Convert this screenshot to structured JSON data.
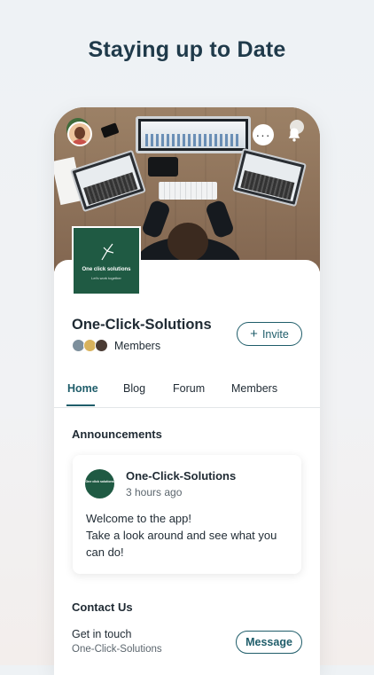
{
  "headline": "Staying up to Date",
  "group": {
    "name": "One-Click-Solutions",
    "members_label": "Members",
    "invite_label": "Invite",
    "logo_title": "One click solutions",
    "logo_subtitle": "Let's work together"
  },
  "tabs": [
    {
      "label": "Home",
      "active": true
    },
    {
      "label": "Blog",
      "active": false
    },
    {
      "label": "Forum",
      "active": false
    },
    {
      "label": "Members",
      "active": false
    }
  ],
  "announcements": {
    "title": "Announcements",
    "post": {
      "author": "One-Click-Solutions",
      "time": "3 hours ago",
      "lines": [
        "Welcome to the app!",
        "Take a look around and see what you",
        "can do!"
      ]
    }
  },
  "contact": {
    "title": "Contact Us",
    "subtitle": "Get in touch",
    "name": "One-Click-Solutions",
    "message_label": "Message"
  },
  "icons": {
    "more": "more-icon",
    "bell": "bell-icon",
    "plus": "plus-icon"
  },
  "colors": {
    "accent": "#1f5d6a",
    "brand_green": "#1f5a43",
    "headline": "#1f3a4a"
  }
}
